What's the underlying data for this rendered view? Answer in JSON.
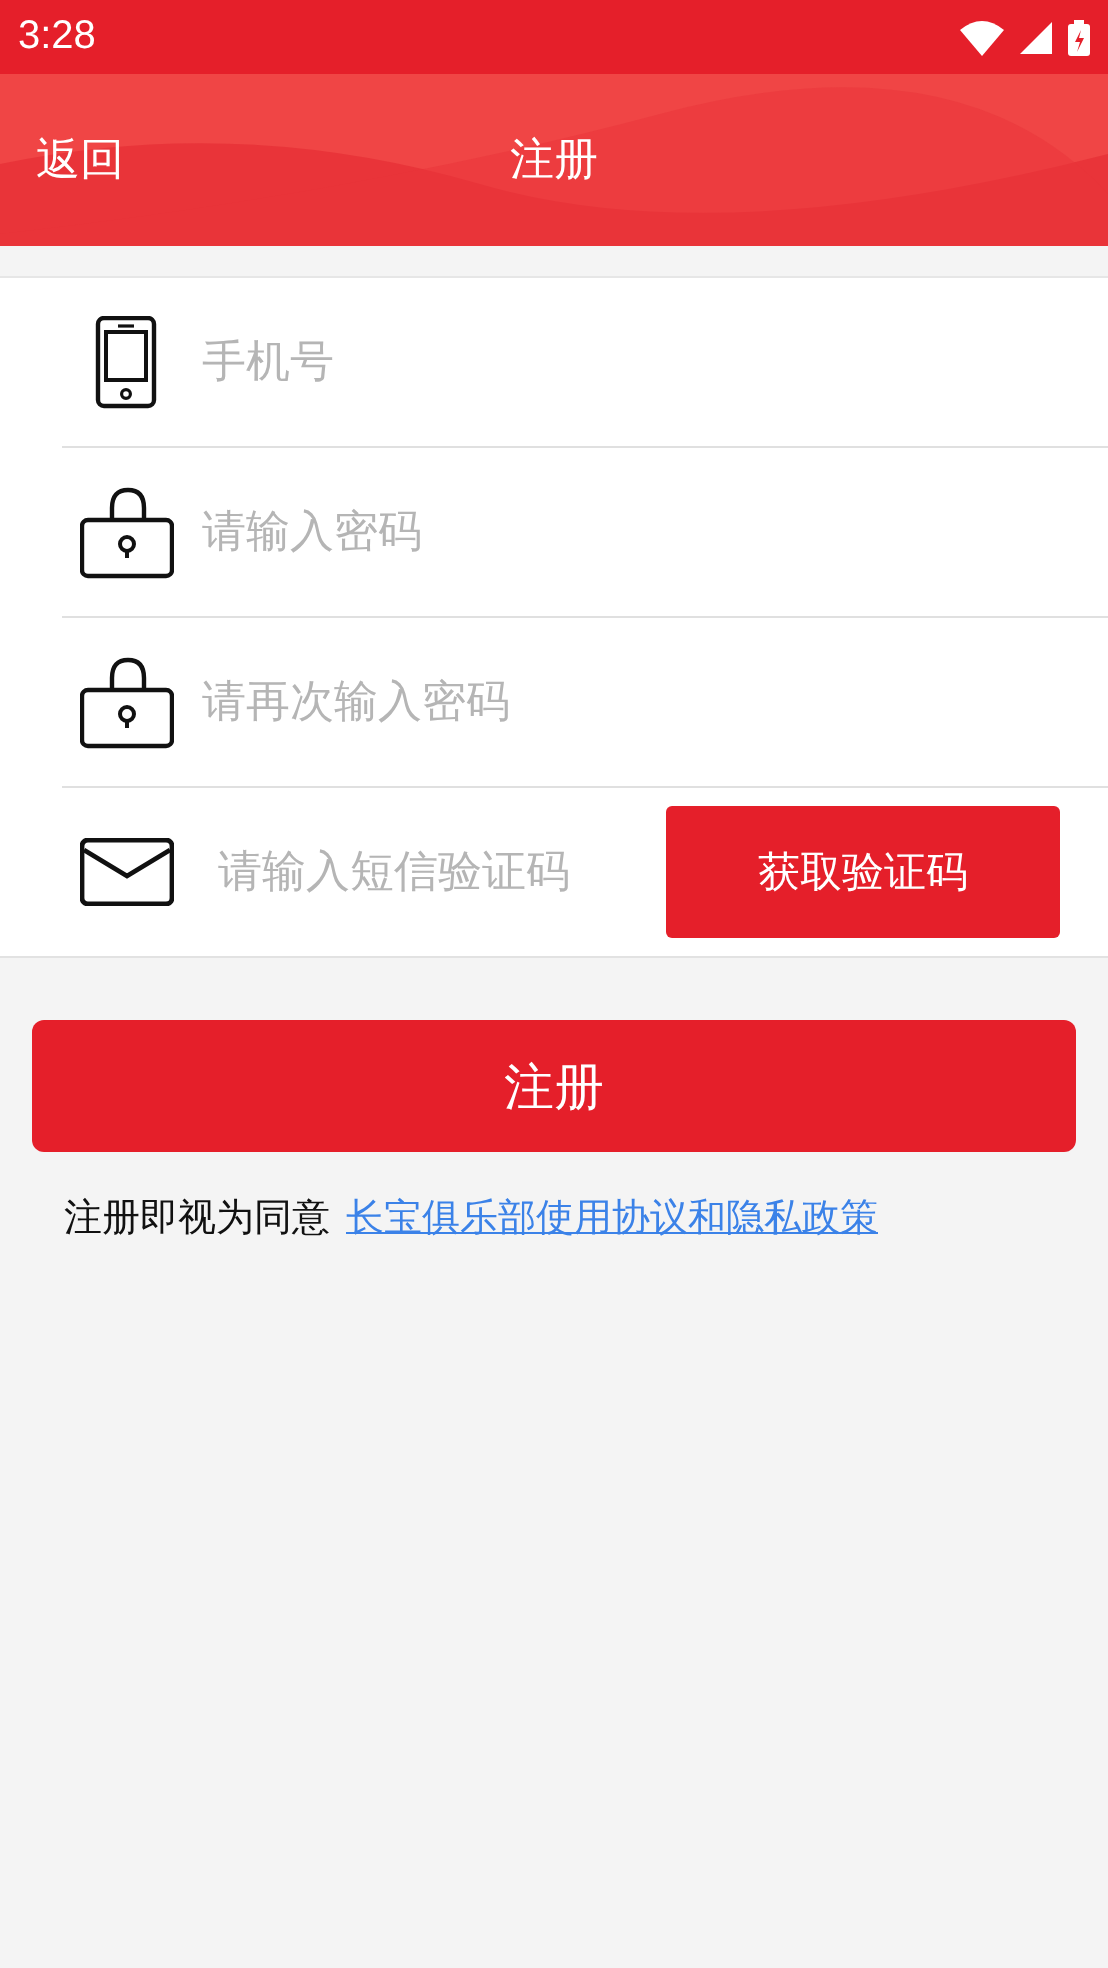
{
  "status_bar": {
    "time": "3:28"
  },
  "header": {
    "back": "返回",
    "title": "注册"
  },
  "fields": [
    {
      "kind": "phone",
      "placeholder": "手机号"
    },
    {
      "kind": "password",
      "placeholder": "请输入密码"
    },
    {
      "kind": "password",
      "placeholder": "请再次输入密码"
    },
    {
      "kind": "sms",
      "placeholder": "请输入短信验证码",
      "button": "获取验证码"
    }
  ],
  "submit": "注册",
  "agreement": {
    "text": "注册即视为同意",
    "link": "长宝俱乐部使用协议和隐私政策"
  }
}
